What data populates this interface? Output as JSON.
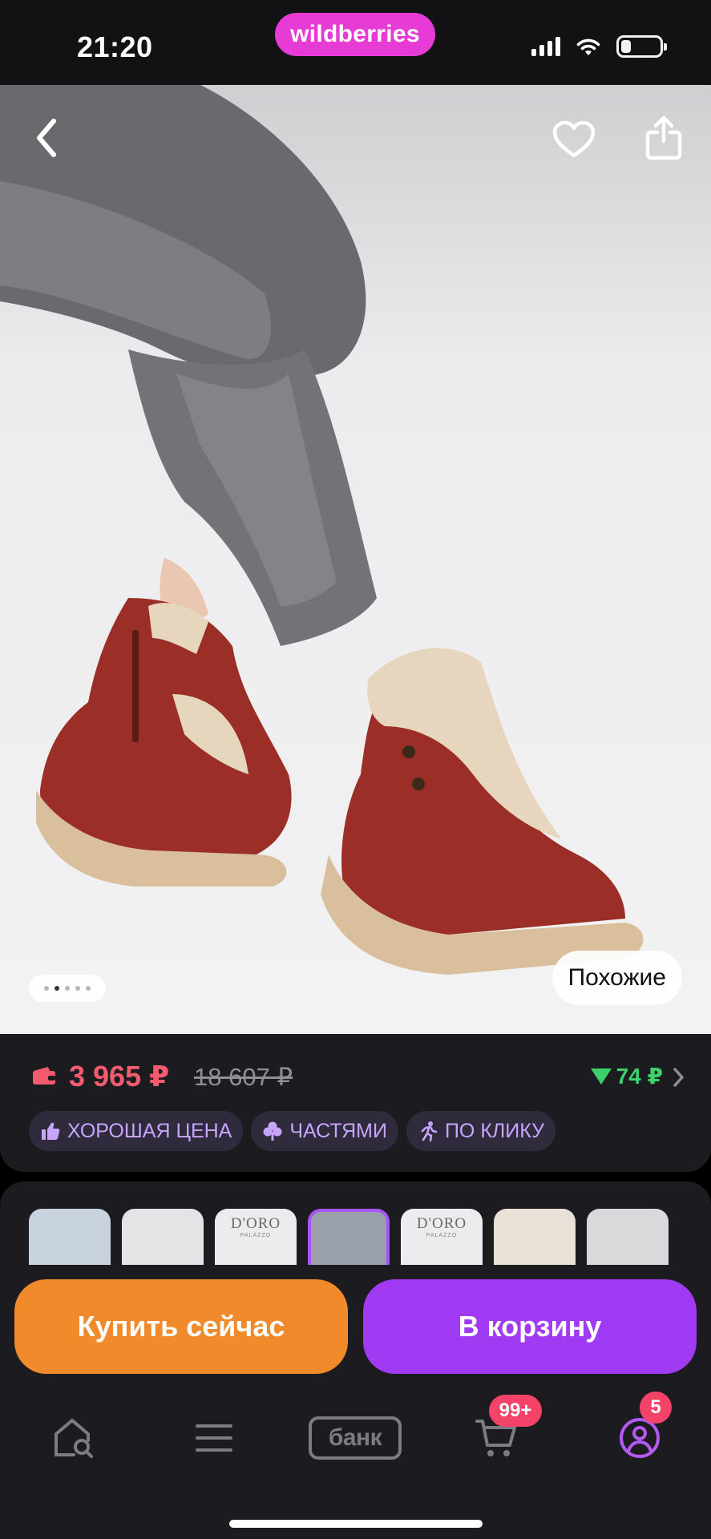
{
  "status_bar": {
    "time": "21:20",
    "brand_logo": "wildberries",
    "signal_strength_bars": 4,
    "battery_level": 0.25,
    "icons": [
      "cellular-signal-icon",
      "wifi-icon",
      "battery-icon"
    ]
  },
  "product_image": {
    "slide_count": 5,
    "active_slide_index": 1,
    "similar_label": "Похожие",
    "icons": [
      "back-chevron-icon",
      "heart-icon",
      "share-icon"
    ]
  },
  "pricing": {
    "price": "3 965 ₽",
    "old_price": "18 607 ₽",
    "cashback": "74 ₽",
    "price_color": "#f45b6f",
    "cashback_color": "#3dd16a",
    "badges": [
      {
        "label": "ХОРОШАЯ ЦЕНА",
        "icon": "thumbs-up-icon"
      },
      {
        "label": "ЧАСТЯМИ",
        "icon": "clover-icon"
      },
      {
        "label": "ПО КЛИКУ",
        "icon": "running-person-icon"
      }
    ]
  },
  "thumbnails": {
    "count": 7,
    "active_index": 3,
    "items": [
      {
        "brand": "",
        "sub": ""
      },
      {
        "brand": "",
        "sub": ""
      },
      {
        "brand": "D'ORO",
        "sub": "PALAZZO"
      },
      {
        "brand": "",
        "sub": ""
      },
      {
        "brand": "D'ORO",
        "sub": "PALAZZO"
      },
      {
        "brand": "",
        "sub": ""
      },
      {
        "brand": "",
        "sub": ""
      }
    ]
  },
  "actions": {
    "buy_now": "Купить сейчас",
    "add_to_cart": "В корзину",
    "buy_now_color": "#f08a2a",
    "add_to_cart_color": "#a13af3"
  },
  "tabbar": {
    "bank_label": "банк",
    "cart_count": "99+",
    "profile_count": "5",
    "icons": [
      "home-search-icon",
      "menu-icon",
      "bank-icon",
      "cart-icon",
      "profile-icon"
    ]
  }
}
